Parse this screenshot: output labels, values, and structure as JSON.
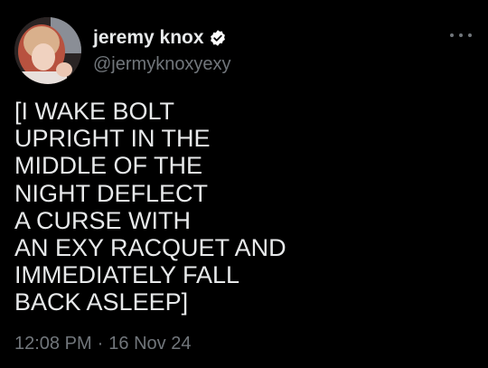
{
  "tweet": {
    "display_name": "jeremy knox",
    "handle": "@jermyknoxyexy",
    "text": "[I WAKE BOLT\nUPRIGHT IN THE\nMIDDLE OF THE\nNIGHT DEFLECT\nA CURSE WITH\nAN EXY RACQUET AND\nIMMEDIATELY FALL\nBACK ASLEEP]",
    "time": "12:08 PM",
    "separator": "·",
    "date": "16 Nov 24",
    "verified": true
  },
  "icons": {
    "verified": "verified-badge-icon",
    "more": "more-options-icon"
  },
  "colors": {
    "background": "#000000",
    "primary_text": "#e7e9ea",
    "secondary_text": "#71767b"
  }
}
